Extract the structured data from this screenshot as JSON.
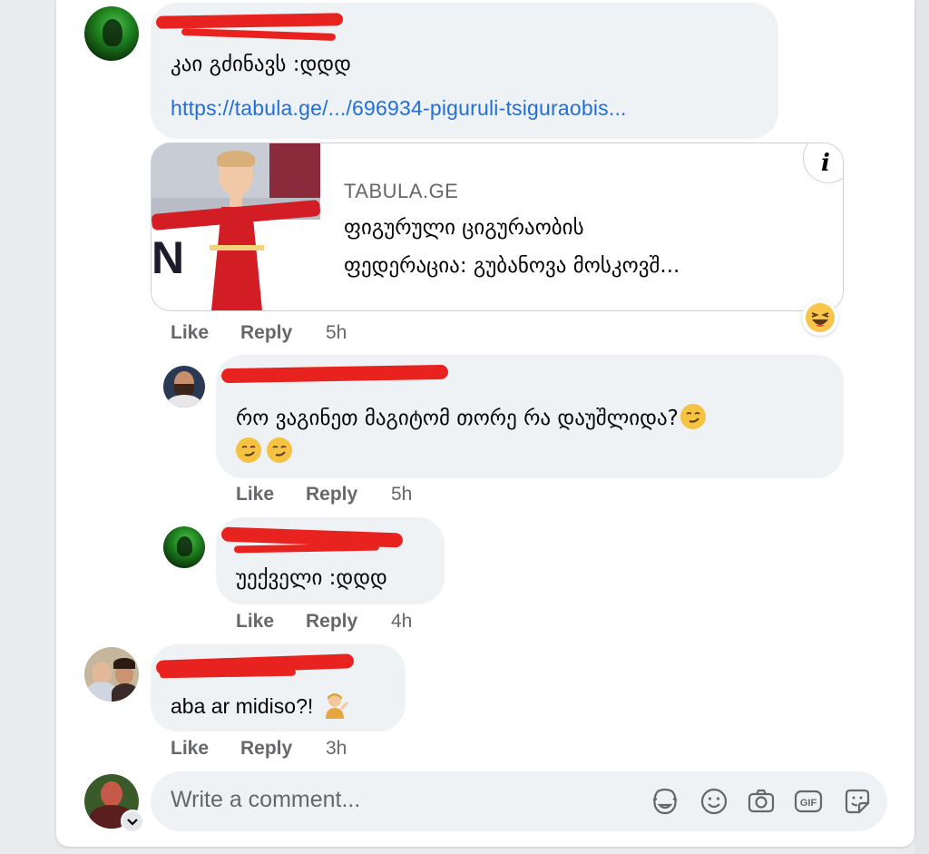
{
  "comments": [
    {
      "text": "კაი გძინავს :დდდ",
      "link": "https://tabula.ge/.../696934-piguruli-tsiguraobis...",
      "preview": {
        "site": "TABULA.GE",
        "title_line1": "ფიგურული ციგურაობის",
        "title_line2": "ფედერაცია: გუბანოვა მოსკოვშ..."
      },
      "actions": {
        "like": "Like",
        "reply": "Reply",
        "time": "5h"
      }
    },
    {
      "text": "რო ვაგინეთ მაგიტომ თორე რა დაუშლიდა?",
      "actions": {
        "like": "Like",
        "reply": "Reply",
        "time": "5h"
      }
    },
    {
      "text": "უექველი :დდდ",
      "actions": {
        "like": "Like",
        "reply": "Reply",
        "time": "4h"
      }
    },
    {
      "text": "aba ar midiso?!",
      "actions": {
        "like": "Like",
        "reply": "Reply",
        "time": "3h"
      }
    }
  ],
  "composer": {
    "placeholder": "Write a comment..."
  },
  "icons": {
    "reaction": "haha-emoji-icon",
    "smirk": "smirk-emoji-icon",
    "shrug": "person-tipping-hand-emoji-icon",
    "avatar_sticker": "avatar-sticker-icon",
    "emoji": "emoji-icon",
    "camera": "camera-icon",
    "gif": "gif-icon",
    "sticker": "sticker-icon",
    "info": "info-icon"
  },
  "colors": {
    "link": "#216fdb",
    "bubble": "#eff2f5",
    "meta": "#65676b",
    "redaction": "#e8231f"
  }
}
